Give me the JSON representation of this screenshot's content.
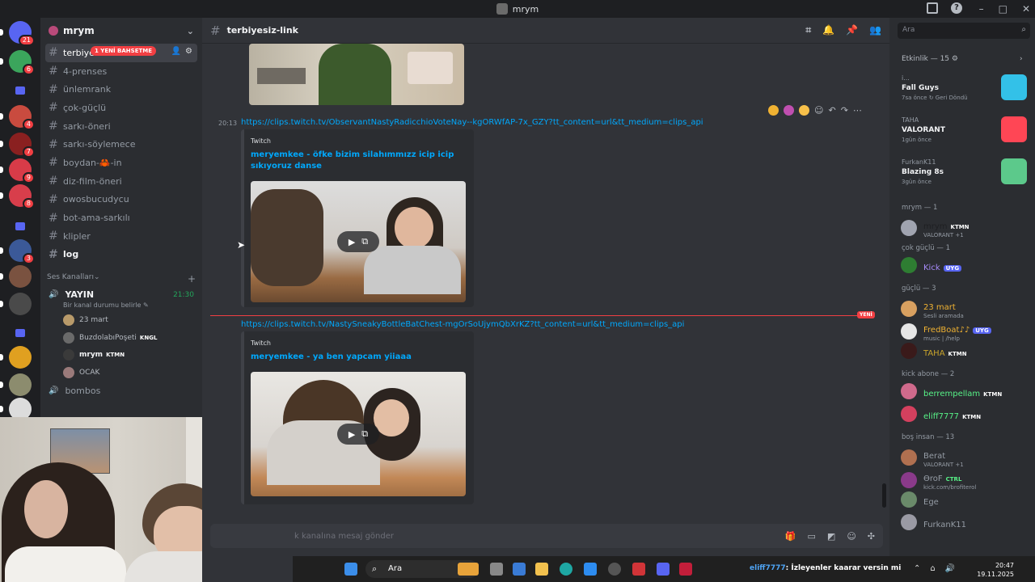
{
  "window": {
    "title": "mrym"
  },
  "servers": [
    {
      "icon": "discord-home-icon",
      "badge": "21"
    },
    {
      "icon": "server-a",
      "badge": "6"
    },
    {
      "icon": "folder-icon",
      "badge": ""
    },
    {
      "icon": "server-b",
      "badge": "4"
    },
    {
      "icon": "server-c",
      "badge": "7"
    },
    {
      "icon": "server-d",
      "badge": "9"
    },
    {
      "icon": "server-e",
      "badge": "8"
    },
    {
      "icon": "folder-icon",
      "badge": ""
    },
    {
      "icon": "server-f",
      "badge": "3"
    },
    {
      "icon": "server-g",
      "badge": ""
    },
    {
      "icon": "server-h",
      "badge": ""
    },
    {
      "icon": "folder-icon",
      "badge": ""
    },
    {
      "icon": "server-i",
      "badge": ""
    },
    {
      "icon": "server-j",
      "badge": ""
    },
    {
      "icon": "server-k",
      "badge": ""
    }
  ],
  "server": {
    "name": "mrym"
  },
  "channels": [
    {
      "name": "terbiyesiz-link",
      "display": "terbiyes",
      "active": true,
      "badge": "1 YENİ BAHSETME"
    },
    {
      "name": "4-prenses"
    },
    {
      "name": "ünlemrank"
    },
    {
      "name": "çok-güçlü"
    },
    {
      "name": "sarkı-öneri"
    },
    {
      "name": "sarkı-söylemece"
    },
    {
      "name": "boydan-🦀-in"
    },
    {
      "name": "diz-film-öneri"
    },
    {
      "name": "owosbucudycu"
    },
    {
      "name": "bot-ama-sarkılı"
    },
    {
      "name": "klipler"
    },
    {
      "name": "log",
      "bold": true
    }
  ],
  "voice": {
    "category": "Ses Kanalları",
    "channel": "YAYIN",
    "time": "21:30",
    "status": "Bir kanal durumu belirle",
    "users": [
      {
        "name": "23 mart",
        "tag": ""
      },
      {
        "name": "BuzdolabıPoşeti",
        "tag": "KNGL"
      },
      {
        "name": "mrym",
        "tag": "KTMN"
      },
      {
        "name": "OCAK",
        "tag": ""
      }
    ],
    "other_channel": "bombos"
  },
  "header": {
    "channel": "terbiyesiz-link"
  },
  "messages": [
    {
      "time": "20:13",
      "link": "https://clips.twitch.tv/ObservantNastyRadicchioVoteNay--kgORWfAP-7x_GZY?tt_content=url&tt_medium=clips_api",
      "provider": "Twitch",
      "title": "meryemkee - öfke bizim silahımmızz icip icip sıkıyoruz danse"
    },
    {
      "time": "",
      "link": "https://clips.twitch.tv/NastySneakyBottleBatChest-mgOrSoUjymQbXrKZ?tt_content=url&tt_medium=clips_api",
      "provider": "Twitch",
      "title": "meryemkee - ya ben yapcam yiiaaa"
    }
  ],
  "new_label": "YENİ",
  "input": {
    "placeholder": "k kanalına mesaj gönder"
  },
  "search": {
    "placeholder": "Ara"
  },
  "activity": {
    "header": "Etkinlik — 15",
    "items": [
      {
        "user": "i...",
        "game": "Fall Guys",
        "meta": "7sa önce  ↻ Geri Döndü",
        "color": "#33c1e8"
      },
      {
        "user": "TAHA",
        "game": "VALORANT",
        "meta": "1gün önce",
        "color": "#ff4655"
      },
      {
        "user": "FurkanK11",
        "game": "Blazing 8s",
        "meta": "3gün önce",
        "color": "#5cc98b"
      }
    ]
  },
  "member_groups": [
    {
      "title": "mrym — 1",
      "members": [
        {
          "name": "mrym",
          "tag": "KTMN",
          "sub": "VALORANT +1",
          "color": "#1e1f22"
        }
      ]
    },
    {
      "title": "çok güçlü — 1",
      "members": [
        {
          "name": "Kick",
          "tag": "UYG",
          "sub": "",
          "color": "#a78bfa"
        }
      ]
    },
    {
      "title": "güçlü — 3",
      "members": [
        {
          "name": "23 mart",
          "tag": "",
          "sub": "Sesli aramada",
          "color": "#f0b232"
        },
        {
          "name": "FredBoat♪♪",
          "tag": "UYG",
          "sub": "music | /help",
          "color": "#f0b232"
        },
        {
          "name": "TAHA",
          "tag": "KTMN",
          "sub": "",
          "color": "#c9a42b"
        }
      ]
    },
    {
      "title": "kick abone — 2",
      "members": [
        {
          "name": "berrempellam",
          "tag": "KTMN",
          "sub": "",
          "color": "#57f287"
        },
        {
          "name": "eliff7777",
          "tag": "KTMN",
          "sub": "",
          "color": "#57f287"
        }
      ]
    },
    {
      "title": "boş insan — 13",
      "members": [
        {
          "name": "Berat",
          "tag": "",
          "sub": "VALORANT +1",
          "color": "#949ba4"
        },
        {
          "name": "ƟroF",
          "tag": "CTRL",
          "sub": "kick.com/brofiterol",
          "color": "#949ba4"
        },
        {
          "name": "Ege",
          "tag": "",
          "sub": "",
          "color": "#949ba4"
        },
        {
          "name": "FurkanK11",
          "tag": "",
          "sub": "",
          "color": "#949ba4"
        }
      ]
    }
  ],
  "taskbar": {
    "search": "Ara",
    "ticker_user": "eliff7777",
    "ticker_text": ": İzleyenler kaarar versin mi",
    "time": "20:47",
    "date": "19.11.2025"
  }
}
